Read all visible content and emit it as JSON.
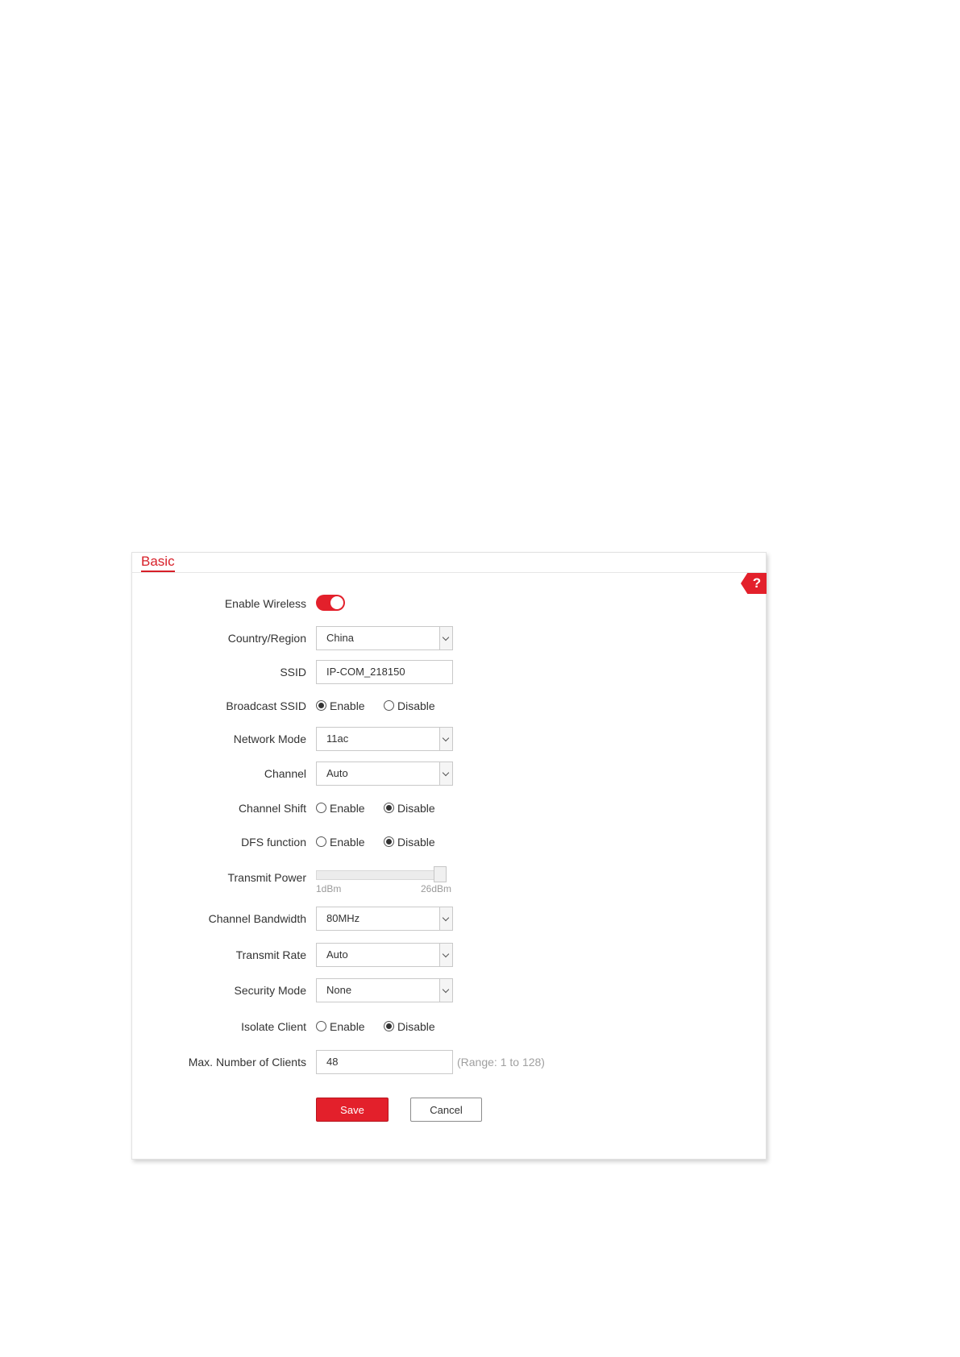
{
  "panel": {
    "title": "Basic",
    "help_label": "?"
  },
  "fields": {
    "enable_wireless": {
      "label": "Enable Wireless",
      "state": "on"
    },
    "country_region": {
      "label": "Country/Region",
      "value": "China"
    },
    "ssid": {
      "label": "SSID",
      "value": "IP-COM_218150"
    },
    "broadcast_ssid": {
      "label": "Broadcast SSID",
      "options": [
        "Enable",
        "Disable"
      ],
      "selected": "Enable"
    },
    "network_mode": {
      "label": "Network Mode",
      "value": "11ac"
    },
    "channel": {
      "label": "Channel",
      "value": "Auto"
    },
    "channel_shift": {
      "label": "Channel Shift",
      "options": [
        "Enable",
        "Disable"
      ],
      "selected": "Disable"
    },
    "dfs_function": {
      "label": "DFS function",
      "options": [
        "Enable",
        "Disable"
      ],
      "selected": "Disable"
    },
    "transmit_power": {
      "label": "Transmit Power",
      "min_label": "1dBm",
      "max_label": "26dBm",
      "level": 1.0
    },
    "channel_bandwidth": {
      "label": "Channel Bandwidth",
      "value": "80MHz"
    },
    "transmit_rate": {
      "label": "Transmit Rate",
      "value": "Auto"
    },
    "security_mode": {
      "label": "Security Mode",
      "value": "None"
    },
    "isolate_client": {
      "label": "Isolate Client",
      "options": [
        "Enable",
        "Disable"
      ],
      "selected": "Disable"
    },
    "max_clients": {
      "label": "Max. Number of Clients",
      "value": "48",
      "hint": "(Range: 1 to 128)"
    }
  },
  "buttons": {
    "save": "Save",
    "cancel": "Cancel"
  },
  "colors": {
    "accent": "#e3202b"
  }
}
